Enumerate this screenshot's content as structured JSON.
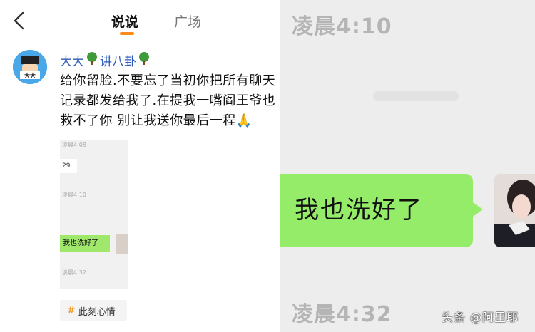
{
  "nav": {
    "back_icon": "chevron-left-icon",
    "tabs": [
      {
        "label": "说说",
        "active": true
      },
      {
        "label": "广场",
        "active": false
      }
    ],
    "accent": "#ff8c1a"
  },
  "post": {
    "author_name": "大大",
    "author_suffix": "讲八卦",
    "author_color": "#2c5bb8",
    "text": "给你留脸.不要忘了当初你把所有聊天记录都发给我了.在提我一嘴阎王爷也救不了你 别让我送你最后一程🙏",
    "thumbnail": {
      "time_1": "凌晨4:08",
      "bubble_text": "29",
      "time_2": "凌晨4:10",
      "green_bubble": "我也洗好了",
      "time_3": "凌晨4:32"
    },
    "tag": "此刻心情"
  },
  "chat": {
    "time_top": "凌晨4:10",
    "message": "我也洗好了",
    "time_bottom": "凌晨4:32",
    "bubble_color": "#95ec69"
  },
  "watermark": "头条 @阿里耶"
}
